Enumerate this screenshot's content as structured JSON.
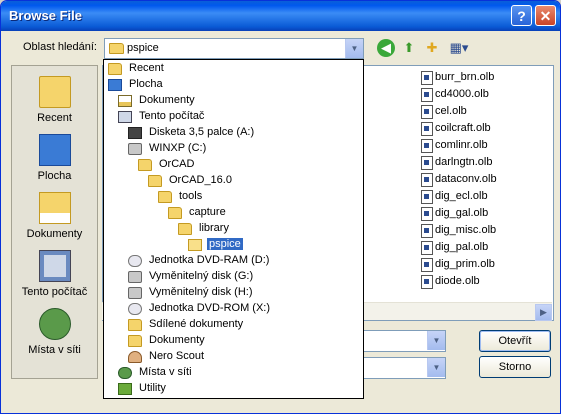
{
  "window": {
    "title": "Browse File",
    "help_glyph": "?",
    "close_glyph": "✕"
  },
  "lookin": {
    "label": "Oblast hledání:",
    "value": "pspice"
  },
  "toolbar_icons": [
    "back-icon",
    "up-folder-icon",
    "new-folder-icon",
    "view-menu-icon"
  ],
  "places": [
    {
      "label": "Recent",
      "icon": "recent-icon"
    },
    {
      "label": "Plocha",
      "icon": "desktop-icon"
    },
    {
      "label": "Dokumenty",
      "icon": "documents-icon"
    },
    {
      "label": "Tento počítač",
      "icon": "my-computer-icon"
    },
    {
      "label": "Místa v síti",
      "icon": "network-icon"
    }
  ],
  "files": [
    "burr_brn.olb",
    "cd4000.olb",
    "cel.olb",
    "coilcraft.olb",
    "comlinr.olb",
    "darlngtn.olb",
    "dataconv.olb",
    "dig_ecl.olb",
    "dig_gal.olb",
    "dig_misc.olb",
    "dig_pal.olb",
    "dig_prim.olb",
    "diode.olb"
  ],
  "dropdown": {
    "items": [
      {
        "label": "Recent",
        "icon": "folder",
        "level": 0
      },
      {
        "label": "Plocha",
        "icon": "desktop",
        "level": 0
      },
      {
        "label": "Dokumenty",
        "icon": "docs",
        "level": 1
      },
      {
        "label": "Tento počítač",
        "icon": "pc",
        "level": 1
      },
      {
        "label": "Disketa 3,5 palce (A:)",
        "icon": "floppy",
        "level": 2
      },
      {
        "label": "WINXP (C:)",
        "icon": "drive",
        "level": 2
      },
      {
        "label": "OrCAD",
        "icon": "folder",
        "level": 3
      },
      {
        "label": "OrCAD_16.0",
        "icon": "folder",
        "level": 4
      },
      {
        "label": "tools",
        "icon": "folder",
        "level": 5
      },
      {
        "label": "capture",
        "icon": "folder",
        "level": 6
      },
      {
        "label": "library",
        "icon": "folder",
        "level": 7
      },
      {
        "label": "pspice",
        "icon": "folder-open",
        "level": 8,
        "selected": true
      },
      {
        "label": "Jednotka DVD-RAM (D:)",
        "icon": "cd",
        "level": 2
      },
      {
        "label": "Vyměnitelný disk (G:)",
        "icon": "drive",
        "level": 2
      },
      {
        "label": "Vyměnitelný disk (H:)",
        "icon": "drive",
        "level": 2
      },
      {
        "label": "Jednotka DVD-ROM (X:)",
        "icon": "cd",
        "level": 2
      },
      {
        "label": "Sdílené dokumenty",
        "icon": "folder",
        "level": 2
      },
      {
        "label": "Dokumenty",
        "icon": "folder",
        "level": 2
      },
      {
        "label": "Nero Scout",
        "icon": "user",
        "level": 2
      },
      {
        "label": "Místa v síti",
        "icon": "net",
        "level": 1
      },
      {
        "label": "Utility",
        "icon": "util",
        "level": 1
      }
    ]
  },
  "buttons": {
    "open": "Otevřít",
    "cancel": "Storno"
  },
  "colors": {
    "titlebar": "#0058ee",
    "selection": "#316ac5"
  }
}
